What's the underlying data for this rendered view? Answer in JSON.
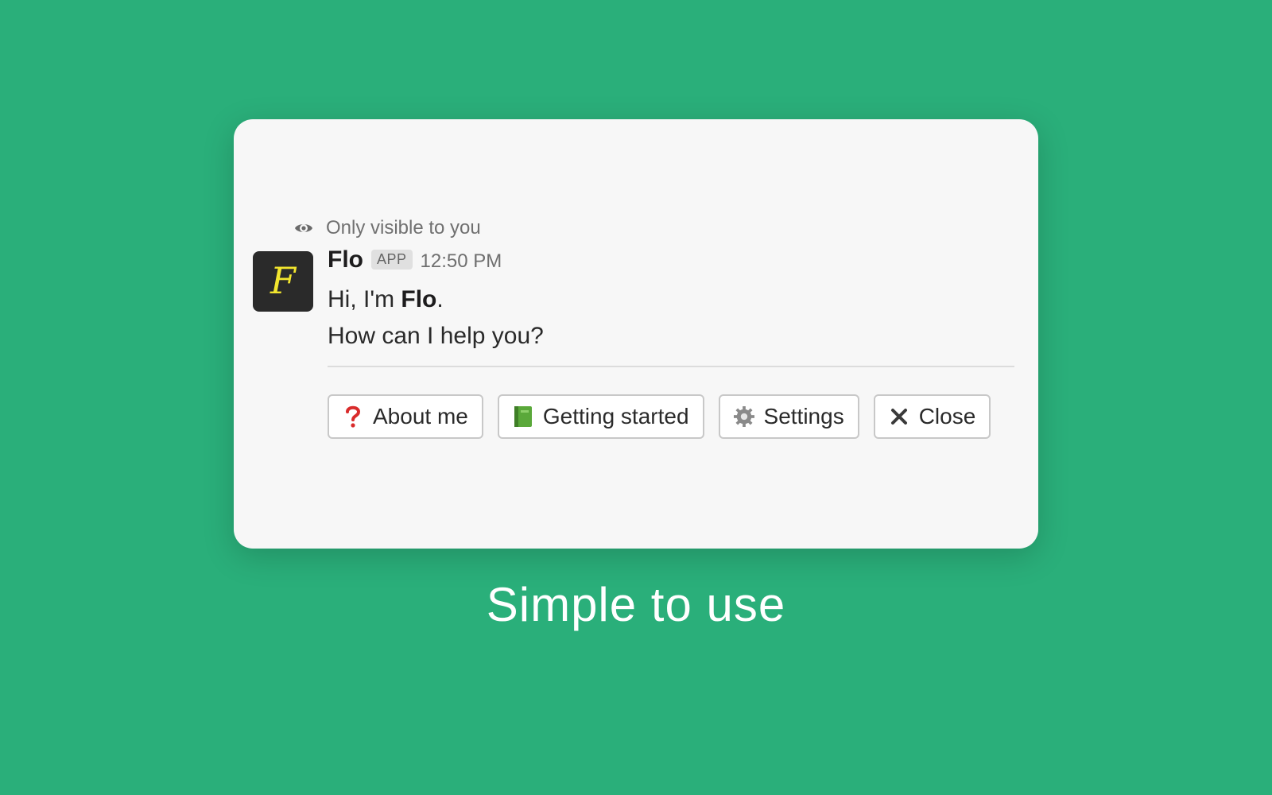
{
  "colors": {
    "background": "#2aaf7a",
    "card": "#f7f7f7",
    "avatar_bg": "#2a2a2a",
    "avatar_letter": "#f2e52e",
    "question_mark": "#d92b2b",
    "book": "#5aa83a"
  },
  "message": {
    "visibility_icon": "eye-icon",
    "visibility_text": "Only visible to you",
    "sender": "Flo",
    "badge": "APP",
    "time": "12:50 PM",
    "line1_prefix": "Hi, I'm ",
    "line1_name": "Flo",
    "line1_suffix": ".",
    "line2": "How can I help you?",
    "avatar_letter": "F"
  },
  "buttons": [
    {
      "icon": "question-mark-icon",
      "label": "About me"
    },
    {
      "icon": "green-book-icon",
      "label": "Getting started"
    },
    {
      "icon": "gear-icon",
      "label": "Settings"
    },
    {
      "icon": "close-icon",
      "label": "Close"
    }
  ],
  "caption": "Simple to use"
}
